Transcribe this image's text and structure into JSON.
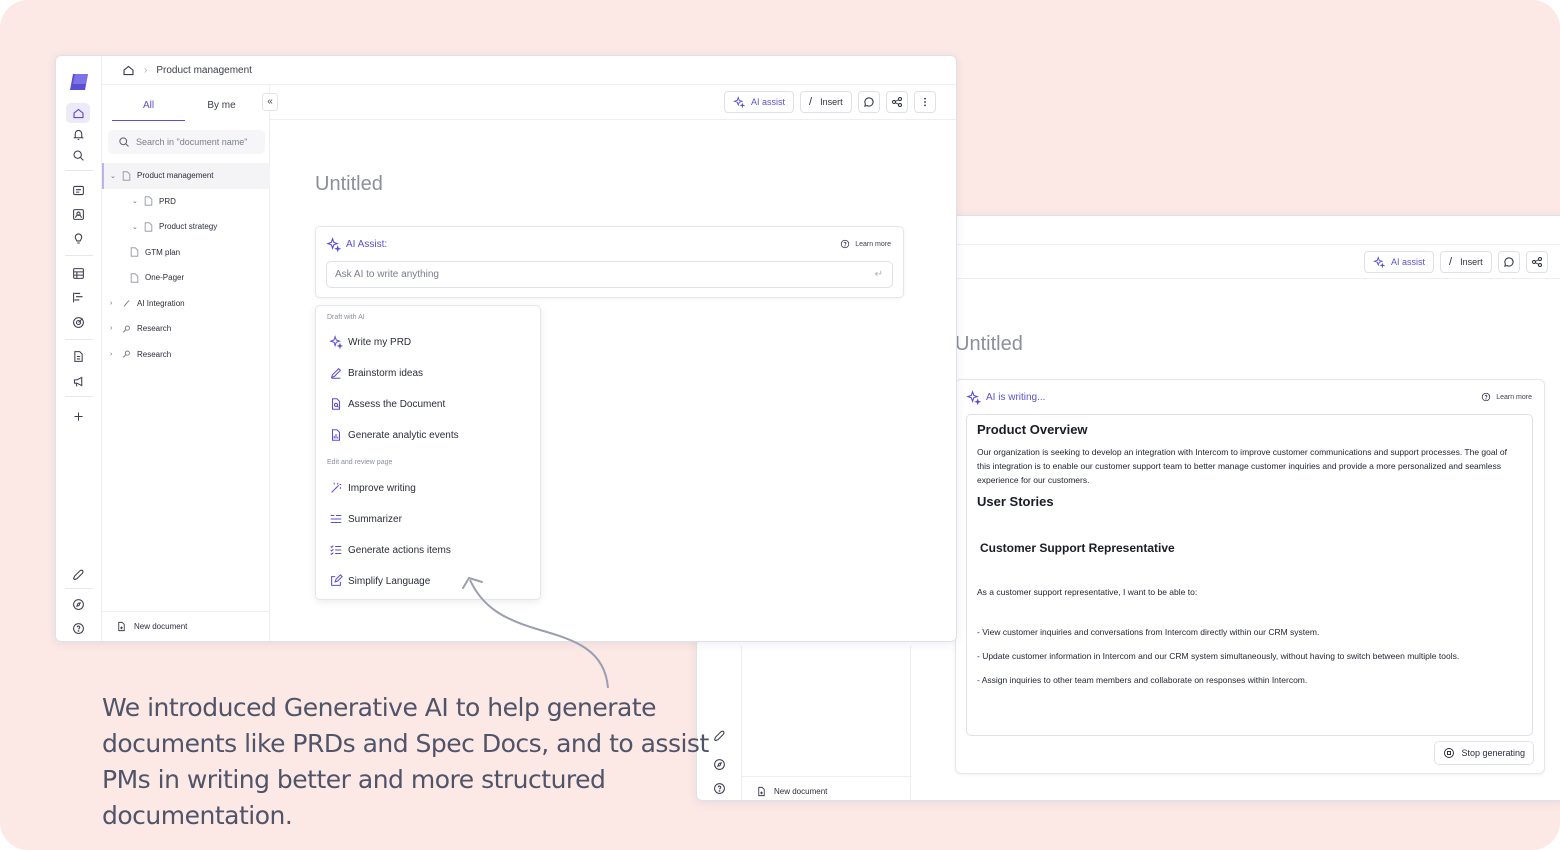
{
  "colors": {
    "background": "#fce9e6",
    "accent": "#5b4fd1",
    "text": "#1f2330",
    "muted": "#8b8f9c"
  },
  "window1": {
    "breadcrumb": {
      "home_icon": "home-icon",
      "page": "Product management"
    },
    "tabs": [
      "All",
      "By me"
    ],
    "search_placeholder": "Search in \"document name\"",
    "tree": [
      {
        "label": "Product management",
        "icon": "document-icon",
        "expanded": true,
        "selected": true,
        "level": 0
      },
      {
        "label": "PRD",
        "icon": "document-icon",
        "expanded": true,
        "level": 1
      },
      {
        "label": "Product strategy",
        "icon": "document-icon",
        "expanded": true,
        "level": 1
      },
      {
        "label": "GTM plan",
        "icon": "document-icon",
        "level": 1
      },
      {
        "label": "One-Pager",
        "icon": "document-icon",
        "level": 1
      },
      {
        "label": "AI Integration",
        "icon": "pen-icon",
        "level": 0
      },
      {
        "label": "Research",
        "icon": "magnifier-icon",
        "level": 0
      },
      {
        "label": "Research",
        "icon": "magnifier-icon",
        "level": 0
      }
    ],
    "new_document": "New document",
    "toolbar": {
      "ai_assist": "AI assist",
      "insert": "Insert"
    },
    "doc_title": "Untitled",
    "ai_box": {
      "label": "AI Assist:",
      "learn_more": "Learn more",
      "input_placeholder": "Ask AI to write anything"
    },
    "menu": {
      "section1": "Draft with AI",
      "section1_items": [
        "Write my PRD",
        "Brainstorm ideas",
        "Assess the Document",
        "Generate analytic events"
      ],
      "section2": "Edit and review page",
      "section2_items": [
        "Improve writing",
        "Summarizer",
        "Generate actions items",
        "Simplify Language"
      ]
    }
  },
  "window2": {
    "toolbar": {
      "ai_assist": "AI assist",
      "insert": "Insert"
    },
    "doc_title": "Untitled",
    "ai_label": "AI is writing...",
    "learn_more": "Learn more",
    "content": {
      "h1": "Product Overview",
      "p1": "Our organization is seeking to develop an integration with Intercom to improve customer communications and support processes. The goal of this integration is to enable our customer support team to better manage customer inquiries and provide a more personalized and seamless experience for our customers.",
      "h2": "User Stories",
      "h3": "Customer Support Representative",
      "p2": "As a customer support representative, I want to be able to:",
      "b1": "- View customer inquiries and conversations from Intercom directly within our CRM system.",
      "b2": "- Update customer information in Intercom and our CRM system simultaneously, without having to switch between multiple tools.",
      "b3": "- Assign inquiries to other team members and collaborate on responses within Intercom."
    },
    "stop_button": "Stop generating",
    "new_document": "New document"
  },
  "caption": "We introduced Generative AI to help generate documents like PRDs and Spec Docs, and to assist PMs in writing better and more structured documentation."
}
